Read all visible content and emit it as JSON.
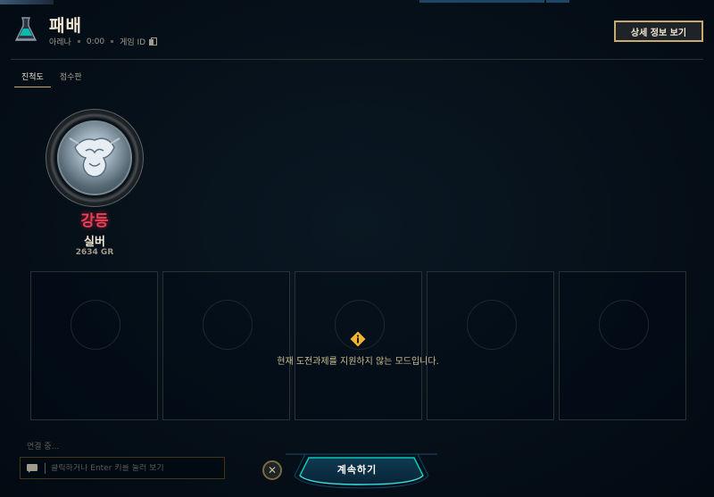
{
  "header": {
    "title": "패배",
    "map": "아레나",
    "duration": "0:00",
    "game_id_label": "게임 ID",
    "details_button": "상세 정보 보기"
  },
  "tabs": [
    {
      "label": "진척도",
      "active": true
    },
    {
      "label": "점수판",
      "active": false
    }
  ],
  "rank": {
    "change": "강등",
    "tier": "실버",
    "rating": "2634 GR"
  },
  "challenges": {
    "slot_count": 5,
    "notice": "현재 도전과제를 지원하지 않는 모드입니다."
  },
  "footer": {
    "connection_status": "연결 중...",
    "chat_placeholder": "클릭하거나 Enter 키를 눌러 보기",
    "continue_button": "계속하기"
  },
  "colors": {
    "gold": "#c8aa6e",
    "defeat_red": "#e84057",
    "accent_blue": "#0ac8b9",
    "notice_yellow": "#f0b232"
  },
  "icons": {
    "mode": "arena-icon",
    "copy": "copy-icon",
    "notice": "warning-diamond-icon",
    "chat": "chat-bubble-icon",
    "close": "close-icon"
  }
}
